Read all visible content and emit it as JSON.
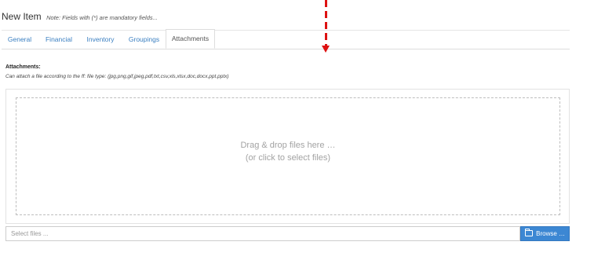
{
  "header": {
    "title": "New Item",
    "note": "Note: Fields with (*) are mandatory fields..."
  },
  "tabs": [
    {
      "label": "General"
    },
    {
      "label": "Financial"
    },
    {
      "label": "Inventory"
    },
    {
      "label": "Groupings"
    },
    {
      "label": "Attachments",
      "active": true
    }
  ],
  "attachments": {
    "label": "Attachments:",
    "hint": "Can attach a file according to the ff: file type: (jpg,png,gif,jpeg,pdf,txt,csv,xls,xlsx,doc,docx,ppt,pptx)",
    "drop_line1": "Drag & drop files here …",
    "drop_line2": "(or click to select files)",
    "file_input_placeholder": "Select files ...",
    "browse_label": "Browse …"
  },
  "colors": {
    "tab_link": "#3a7fc1",
    "browse_bg": "#3c87d3",
    "annotation_arrow": "#dd1111"
  },
  "icons": {
    "browse": "folder-open-icon",
    "annotation": "dashed-arrow-down-icon"
  }
}
